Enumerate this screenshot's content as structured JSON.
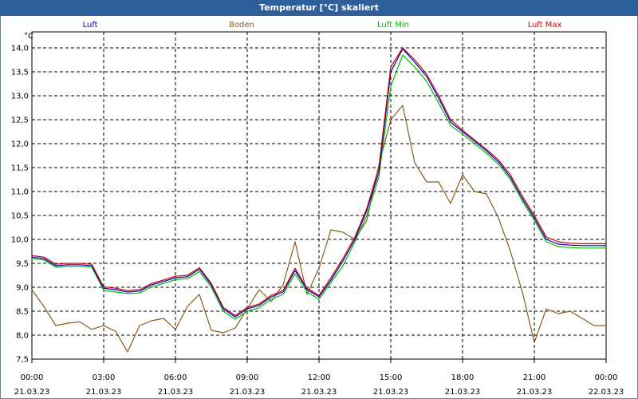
{
  "window": {
    "title": "Temperatur [°C] skaliert"
  },
  "chart_data": {
    "type": "line",
    "title": "Temperatur [°C] skaliert",
    "ylabel": "°C",
    "ylim": [
      7.5,
      14.0
    ],
    "xlim": [
      0,
      24
    ],
    "grid": true,
    "legend_placement": "top",
    "y_ticks": [
      "7,5",
      "8,0",
      "8,5",
      "9,0",
      "9,5",
      "10,0",
      "10,5",
      "11,0",
      "11,5",
      "12,0",
      "12,5",
      "13,0",
      "13,5",
      "14,0"
    ],
    "x_ticks": [
      {
        "time": "00:00",
        "date": "21.03.23"
      },
      {
        "time": "03:00",
        "date": "21.03.23"
      },
      {
        "time": "06:00",
        "date": "21.03.23"
      },
      {
        "time": "09:00",
        "date": "21.03.23"
      },
      {
        "time": "12:00",
        "date": "21.03.23"
      },
      {
        "time": "15:00",
        "date": "21.03.23"
      },
      {
        "time": "18:00",
        "date": "21.03.23"
      },
      {
        "time": "21:00",
        "date": "21.03.23"
      },
      {
        "time": "00:00",
        "date": "22.03.23"
      }
    ],
    "series": [
      {
        "name": "Luft",
        "color": "#0000cc",
        "x": [
          0,
          0.5,
          1,
          1.5,
          2,
          2.5,
          3,
          3.5,
          4,
          4.5,
          5,
          5.5,
          6,
          6.5,
          7,
          7.5,
          8,
          8.5,
          9,
          9.5,
          10,
          10.5,
          11,
          11.5,
          12,
          12.5,
          13,
          13.5,
          14,
          14.5,
          15,
          15.5,
          16,
          16.5,
          17,
          17.5,
          18,
          18.5,
          19,
          19.5,
          20,
          20.5,
          21,
          21.5,
          22,
          22.5,
          23,
          23.5,
          24
        ],
        "y": [
          9.63,
          9.6,
          9.45,
          9.47,
          9.47,
          9.45,
          8.98,
          8.95,
          8.9,
          8.92,
          9.05,
          9.12,
          9.2,
          9.22,
          9.38,
          9.05,
          8.55,
          8.38,
          8.55,
          8.62,
          8.8,
          8.9,
          9.35,
          8.95,
          8.8,
          9.15,
          9.55,
          10.0,
          10.6,
          11.4,
          13.5,
          13.98,
          13.7,
          13.4,
          12.95,
          12.45,
          12.25,
          12.05,
          11.85,
          11.62,
          11.3,
          10.85,
          10.45,
          10.0,
          9.9,
          9.88,
          9.87,
          9.87,
          9.87
        ]
      },
      {
        "name": "Boden",
        "color": "#8b5a1e",
        "x": [
          0,
          0.5,
          1,
          1.5,
          2,
          2.5,
          3,
          3.5,
          4,
          4.5,
          5,
          5.5,
          6,
          6.5,
          7,
          7.5,
          8,
          8.5,
          9,
          9.5,
          10,
          10.5,
          11,
          11.5,
          12,
          12.5,
          13,
          13.5,
          14,
          14.5,
          15,
          15.5,
          16,
          16.5,
          17,
          17.5,
          18,
          18.5,
          19,
          19.5,
          20,
          20.5,
          21,
          21.5,
          22,
          22.5,
          23,
          23.5,
          24
        ],
        "y": [
          8.95,
          8.6,
          8.2,
          8.25,
          8.28,
          8.12,
          8.2,
          8.08,
          7.65,
          8.2,
          8.3,
          8.35,
          8.12,
          8.6,
          8.85,
          8.1,
          8.05,
          8.15,
          8.55,
          8.95,
          8.7,
          9.05,
          9.95,
          8.85,
          9.4,
          10.2,
          10.15,
          10.0,
          10.4,
          11.55,
          12.5,
          12.8,
          11.6,
          11.2,
          11.2,
          10.75,
          11.35,
          11.0,
          10.95,
          10.45,
          9.75,
          8.9,
          7.85,
          8.55,
          8.45,
          8.5,
          8.35,
          8.2,
          8.2
        ]
      },
      {
        "name": "Luft Min",
        "color": "#00bb00",
        "x": [
          0,
          0.5,
          1,
          1.5,
          2,
          2.5,
          3,
          3.5,
          4,
          4.5,
          5,
          5.5,
          6,
          6.5,
          7,
          7.5,
          8,
          8.5,
          9,
          9.5,
          10,
          10.5,
          11,
          11.5,
          12,
          12.5,
          13,
          13.5,
          14,
          14.5,
          15,
          15.5,
          16,
          16.5,
          17,
          17.5,
          18,
          18.5,
          19,
          19.5,
          20,
          20.5,
          21,
          21.5,
          22,
          22.5,
          23,
          23.5,
          24
        ],
        "y": [
          9.6,
          9.57,
          9.42,
          9.44,
          9.44,
          9.42,
          8.94,
          8.9,
          8.87,
          8.88,
          9.01,
          9.08,
          9.16,
          9.18,
          9.33,
          9.0,
          8.5,
          8.33,
          8.5,
          8.57,
          8.75,
          8.85,
          9.28,
          8.9,
          8.75,
          9.1,
          9.45,
          9.95,
          10.5,
          11.3,
          13.2,
          13.85,
          13.6,
          13.3,
          12.85,
          12.38,
          12.2,
          12.0,
          11.8,
          11.57,
          11.25,
          10.8,
          10.4,
          9.95,
          9.85,
          9.83,
          9.82,
          9.82,
          9.82
        ]
      },
      {
        "name": "Luft Max",
        "color": "#cc0000",
        "x": [
          0,
          0.5,
          1,
          1.5,
          2,
          2.5,
          3,
          3.5,
          4,
          4.5,
          5,
          5.5,
          6,
          6.5,
          7,
          7.5,
          8,
          8.5,
          9,
          9.5,
          10,
          10.5,
          11,
          11.5,
          12,
          12.5,
          13,
          13.5,
          14,
          14.5,
          15,
          15.5,
          16,
          16.5,
          17,
          17.5,
          18,
          18.5,
          19,
          19.5,
          20,
          20.5,
          21,
          21.5,
          22,
          22.5,
          23,
          23.5,
          24
        ],
        "y": [
          9.66,
          9.63,
          9.48,
          9.5,
          9.5,
          9.48,
          9.01,
          8.98,
          8.93,
          8.95,
          9.08,
          9.15,
          9.23,
          9.25,
          9.41,
          9.08,
          8.58,
          8.41,
          8.58,
          8.65,
          8.83,
          8.93,
          9.4,
          8.98,
          8.83,
          9.2,
          9.6,
          10.05,
          10.65,
          11.5,
          13.6,
          14.0,
          13.75,
          13.45,
          13.0,
          12.5,
          12.28,
          12.08,
          11.88,
          11.66,
          11.35,
          10.9,
          10.5,
          10.05,
          9.95,
          9.92,
          9.91,
          9.91,
          9.91
        ]
      }
    ]
  }
}
